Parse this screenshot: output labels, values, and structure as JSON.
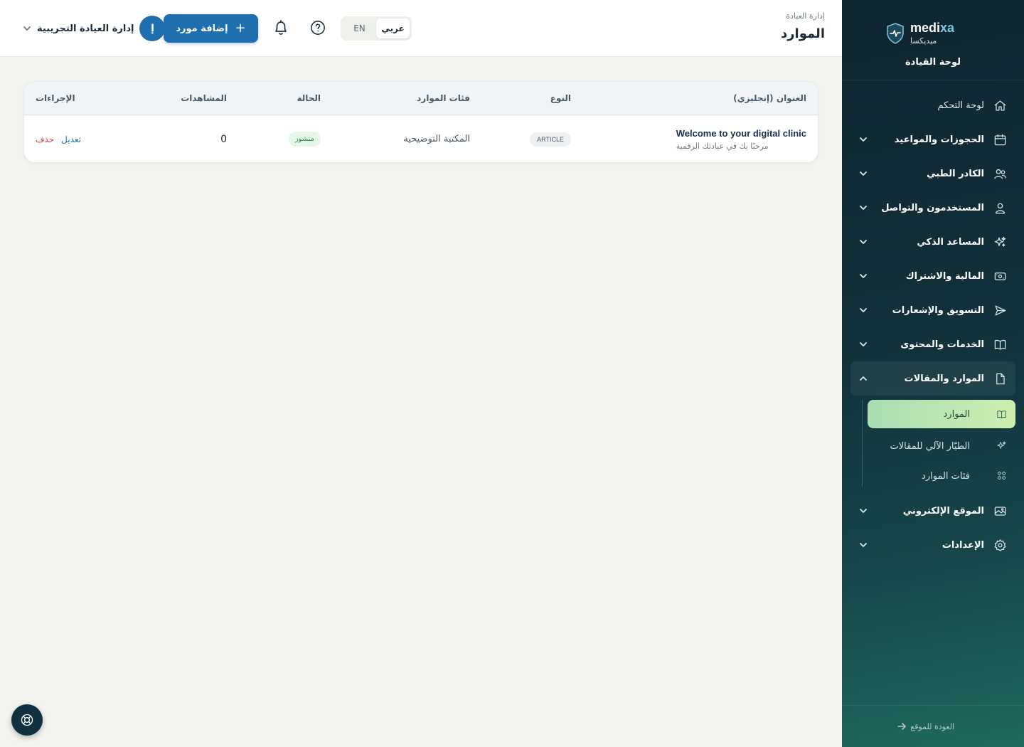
{
  "brand": {
    "name_en_prefix": "medi",
    "name_en_suffix": "xa",
    "name_ar": "ميديكسا",
    "panel_title": "لوحة القيادة"
  },
  "sidebar": {
    "items": [
      {
        "label": "لوحة التحكم",
        "icon": "home-icon"
      },
      {
        "label": "الحجوزات والمواعيد",
        "icon": "calendar-icon"
      },
      {
        "label": "الكادر الطبي",
        "icon": "users-icon"
      },
      {
        "label": "المستخدمون والتواصل",
        "icon": "user-icon"
      },
      {
        "label": "المساعد الذكي",
        "icon": "sparkles-icon"
      },
      {
        "label": "المالية والاشتراك",
        "icon": "cash-icon"
      },
      {
        "label": "التسويق والإشعارات",
        "icon": "send-icon"
      },
      {
        "label": "الخدمات والمحتوى",
        "icon": "book-icon"
      },
      {
        "label": "الموارد والمقالات",
        "icon": "file-icon"
      },
      {
        "label": "الموقع الإلكتروني",
        "icon": "image-icon"
      },
      {
        "label": "الإعدادات",
        "icon": "gear-icon"
      }
    ],
    "sub_items": [
      {
        "label": "الموارد",
        "icon": "book-open-icon"
      },
      {
        "label": "الطيّار الآلي للمقالات",
        "icon": "sparkles-icon"
      },
      {
        "label": "فئات الموارد",
        "icon": "grid-icon"
      }
    ],
    "back_link": "العودة للموقع"
  },
  "header": {
    "breadcrumb": "إدارة العيادة",
    "title": "الموارد",
    "lang_ar": "عربي",
    "lang_en": "EN",
    "add_button": "إضافة مورد",
    "user_initial": "إ",
    "user_name": "إدارة العيادة التجريبية"
  },
  "table": {
    "columns": [
      "العنوان (إنجليزي)",
      "النوع",
      "فئات الموارد",
      "الحالة",
      "المشاهدات",
      "الإجراءات"
    ],
    "rows": [
      {
        "title": "Welcome to your digital clinic",
        "subtitle": "مرحبًا بك في عيادتك الرقمية",
        "type": "ARTICLE",
        "category": "المكتبة التوضيحية",
        "status": "منشور",
        "views": "0",
        "edit": "تعديل",
        "delete": "حذف"
      }
    ]
  },
  "colors": {
    "primary": "#1f6eae",
    "sidebar_dark": "#0f2530",
    "active_green": "#a8ddb4",
    "delete_red": "#d14343",
    "status_green": "#2e8b4e"
  }
}
